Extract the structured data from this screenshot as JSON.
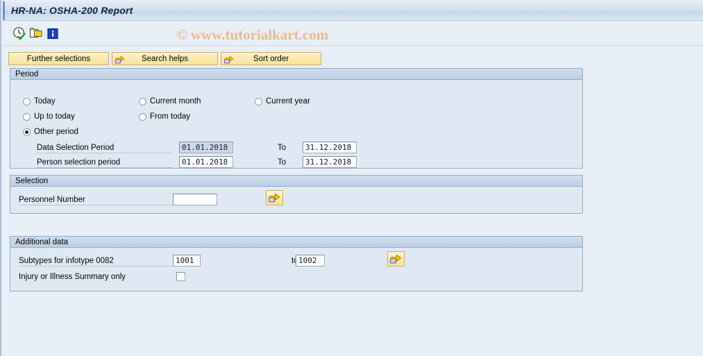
{
  "window": {
    "title": "HR-NA: OSHA-200 Report"
  },
  "watermark": {
    "text": "© www.tutorialkart.com"
  },
  "toolbar": {
    "icons": [
      {
        "name": "execute-icon",
        "title": "Execute"
      },
      {
        "name": "copy-icon",
        "title": "Get Variant"
      },
      {
        "name": "info-icon",
        "title": "Information"
      }
    ]
  },
  "button_row": {
    "further_selections": "Further selections",
    "search_helps": "Search helps",
    "sort_order": "Sort order"
  },
  "period": {
    "header": "Period",
    "radios": [
      {
        "label": "Today",
        "selected": false
      },
      {
        "label": "Up to today",
        "selected": false
      },
      {
        "label": "Other period",
        "selected": true
      },
      {
        "label": "Current month",
        "selected": false
      },
      {
        "label": "From today",
        "selected": false
      },
      {
        "label": "Current year",
        "selected": false
      }
    ],
    "data_selection": {
      "label": "Data Selection Period",
      "from": "01.01.2018",
      "to_label": "To",
      "to": "31.12.2018"
    },
    "person_selection": {
      "label": "Person selection period",
      "from": "01.01.2018",
      "to_label": "To",
      "to": "31.12.2018"
    }
  },
  "selection": {
    "header": "Selection",
    "personnel_number": {
      "label": "Personnel Number",
      "value": "",
      "placeholder": ""
    }
  },
  "additional_data": {
    "header": "Additional data",
    "subtypes": {
      "label": "Subtypes for infotype 0082",
      "from": "1001",
      "to_label": "to",
      "to": "1002"
    },
    "injury_summary": {
      "label": "Injury or Illness Summary only",
      "checked": false
    }
  },
  "colors": {
    "background": "#e9eff7",
    "panel_body": "#e0e9f3",
    "panel_header": "#c6d6e8",
    "panel_border": "#8faac9",
    "button_yellow": "#fae9ac",
    "button_border": "#c9ab5f",
    "title_text": "#14213d",
    "watermark": "#eab98a",
    "input_selected": "#ccd8e8"
  }
}
